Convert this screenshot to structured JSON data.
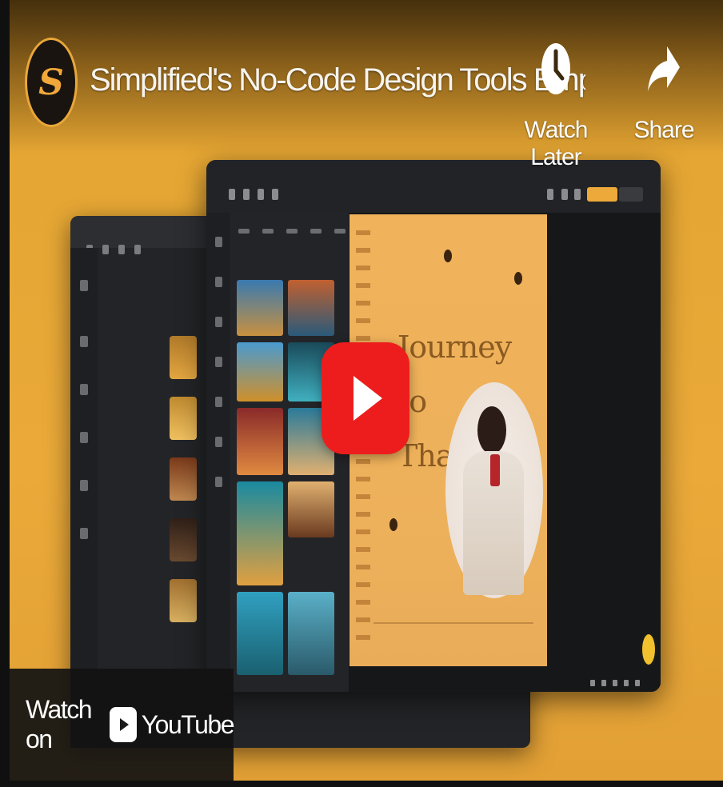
{
  "player": {
    "title": "Simplified's No-Code Design Tools Empowering a",
    "channel_logo_letter": "S",
    "watch_later_label": "Watch Later",
    "share_label": "Share",
    "watch_on_label": "Watch on",
    "youtube_label": "YouTube",
    "accent_color": "#eaa939",
    "play_button_color": "#ee1d1d"
  },
  "poster": {
    "headline_line1": "Journey to",
    "headline_line2": "Thailand"
  },
  "icons": {
    "watch_later": "clock-icon",
    "share": "share-arrow-icon",
    "play": "play-icon",
    "youtube": "youtube-logo-icon"
  }
}
